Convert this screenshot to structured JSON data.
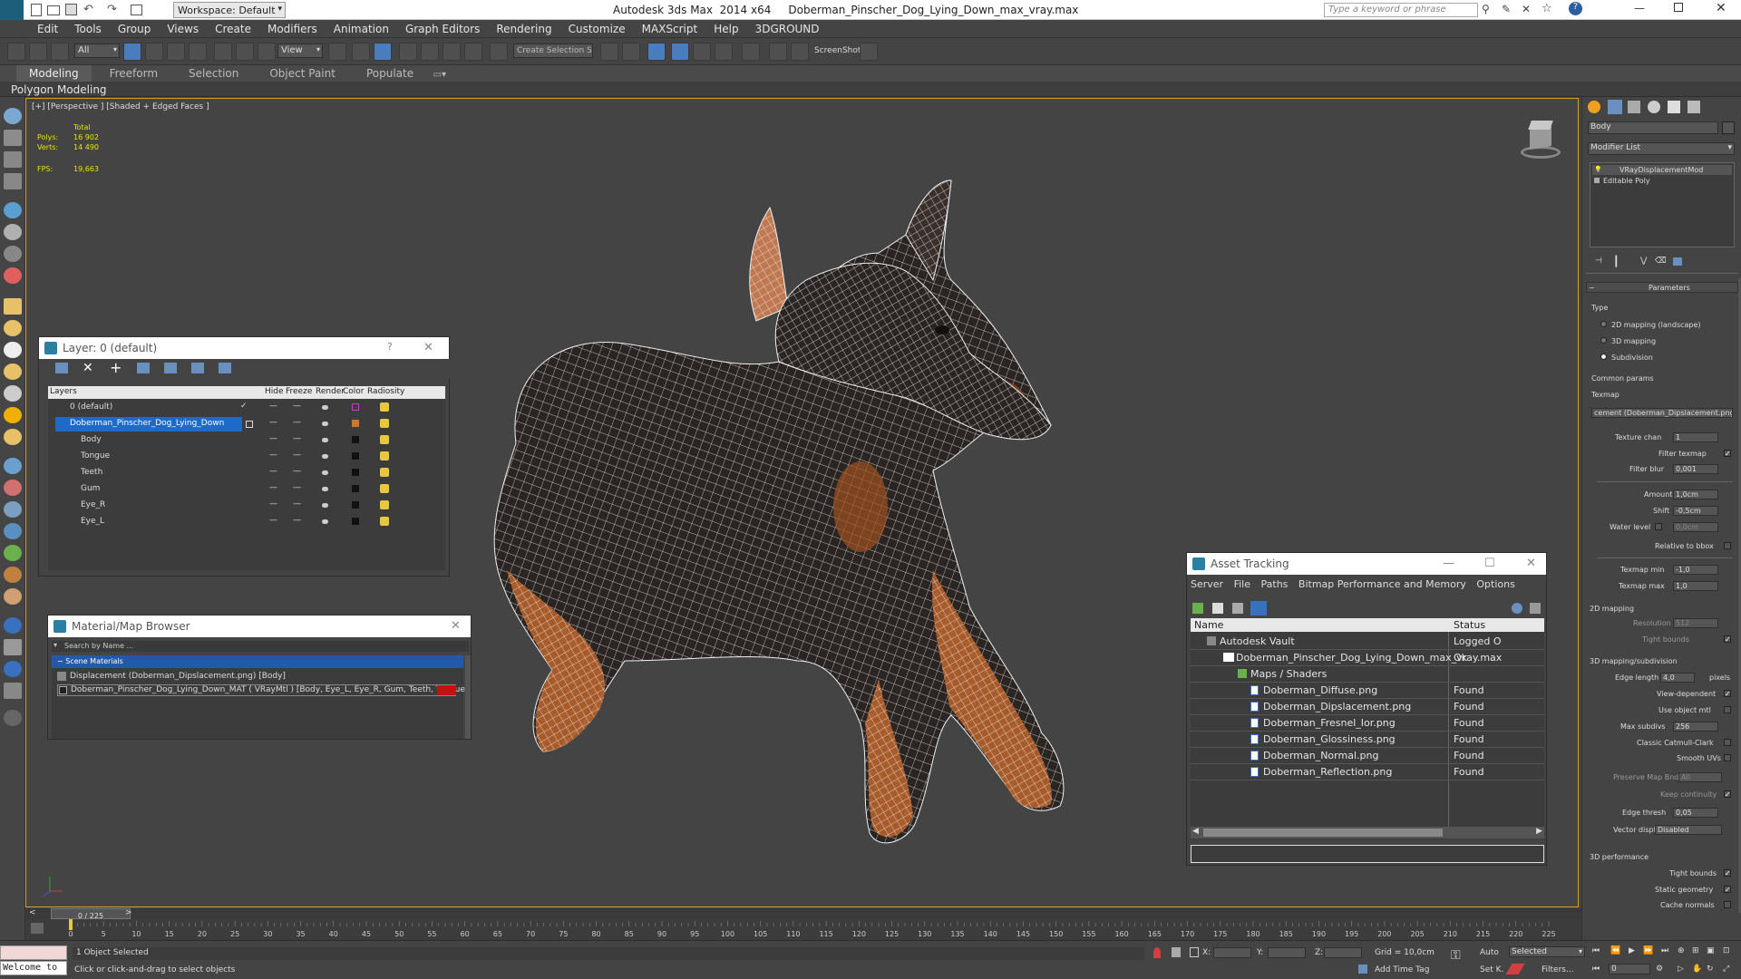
{
  "app": {
    "title": "Autodesk 3ds Max  2014 x64     Doberman_Pinscher_Dog_Lying_Down_max_vray.max",
    "workspace": "Workspace: Default",
    "search_placeholder": "Type a keyword or phrase"
  },
  "menu": [
    "Edit",
    "Tools",
    "Group",
    "Views",
    "Create",
    "Modifiers",
    "Animation",
    "Graph Editors",
    "Rendering",
    "Customize",
    "MAXScript",
    "Help",
    "3DGROUND"
  ],
  "toolbar": {
    "filter": "All",
    "ref_coord": "View",
    "selection_set": "Create Selection S",
    "screenshot": "ScreenShot"
  },
  "ribbon": {
    "tabs": [
      "Modeling",
      "Freeform",
      "Selection",
      "Object Paint",
      "Populate"
    ],
    "active": "Modeling",
    "sub": "Polygon Modeling"
  },
  "viewport": {
    "label": "[+] [Perspective ] [Shaded + Edged Faces ]",
    "stats": {
      "total": "Total",
      "polys_label": "Polys:",
      "polys": "16 902",
      "verts_label": "Verts:",
      "verts": "14 490",
      "fps_label": "FPS:",
      "fps": "19,663"
    }
  },
  "layer_panel": {
    "title": "Layer: 0 (default)",
    "columns": [
      "Layers",
      "Hide",
      "Freeze",
      "Render",
      "Color",
      "Radiosity"
    ],
    "rows": [
      {
        "name": "0 (default)",
        "color": "#c83cc8"
      },
      {
        "name": "Doberman_Pinscher_Dog_Lying_Down",
        "color": "#c87832"
      },
      {
        "name": "Body",
        "color": "#111111"
      },
      {
        "name": "Tongue",
        "color": "#111111"
      },
      {
        "name": "Teeth",
        "color": "#111111"
      },
      {
        "name": "Gum",
        "color": "#111111"
      },
      {
        "name": "Eye_R",
        "color": "#111111"
      },
      {
        "name": "Eye_L",
        "color": "#111111"
      }
    ]
  },
  "material_browser": {
    "title": "Material/Map Browser",
    "search": "Search by Name ...",
    "group": "Scene Materials",
    "items": [
      "Displacement (Doberman_Dipslacement.png) [Body]",
      "Doberman_Pinscher_Dog_Lying_Down_MAT  ( VRayMtl )  [Body, Eye_L, Eye_R, Gum, Teeth, Tongue]"
    ]
  },
  "asset_tracking": {
    "title": "Asset Tracking",
    "menu": [
      "Server",
      "File",
      "Paths",
      "Bitmap Performance and Memory",
      "Options"
    ],
    "columns": [
      "Name",
      "Status"
    ],
    "rows": [
      {
        "name": "Autodesk Vault",
        "status": "Logged O"
      },
      {
        "name": "Doberman_Pinscher_Dog_Lying_Down_max_vray.max",
        "status": "Ok"
      },
      {
        "name": "Maps / Shaders",
        "status": ""
      },
      {
        "name": "Doberman_Diffuse.png",
        "status": "Found"
      },
      {
        "name": "Doberman_Dipslacement.png",
        "status": "Found"
      },
      {
        "name": "Doberman_Fresnel_Ior.png",
        "status": "Found"
      },
      {
        "name": "Doberman_Glossiness.png",
        "status": "Found"
      },
      {
        "name": "Doberman_Normal.png",
        "status": "Found"
      },
      {
        "name": "Doberman_Reflection.png",
        "status": "Found"
      }
    ]
  },
  "command_panel": {
    "object_name": "Body",
    "modifier_list": "Modifier List",
    "stack": [
      "VRayDisplacementMod",
      "Editable Poly"
    ],
    "rollout": "Parameters",
    "type_label": "Type",
    "types": [
      "2D mapping (landscape)",
      "3D mapping",
      "Subdivision"
    ],
    "common": "Common params",
    "texmap_label": "Texmap",
    "texmap": "cement (Doberman_Dipslacement.png)",
    "texture_chan_label": "Texture chan",
    "texture_chan": "1",
    "filter_texmap": "Filter texmap",
    "filter_blur_label": "Filter blur",
    "filter_blur": "0,001",
    "amount_label": "Amount",
    "amount": "1,0cm",
    "shift_label": "Shift",
    "shift": "-0,5cm",
    "water_label": "Water level",
    "water": "0,0cm",
    "relative_bbox": "Relative to bbox",
    "texmap_min_label": "Texmap min",
    "texmap_min": "-1,0",
    "texmap_max_label": "Texmap max",
    "texmap_max": "1,0",
    "mapping2d": "2D mapping",
    "resolution_label": "Resolution",
    "resolution": "512",
    "tight_bounds": "Tight bounds",
    "mapping3d": "3D mapping/subdivision",
    "edge_length_label": "Edge length",
    "edge_length": "4,0",
    "pixels": "pixels",
    "view_dependent": "View-dependent",
    "use_object_mtl": "Use object mtl",
    "max_subdivs_label": "Max subdivs",
    "max_subdivs": "256",
    "classic_catmull": "Classic Catmull-Clark",
    "smooth_uvs": "Smooth UVs",
    "preserve_map": "Preserve Map Bnd",
    "preserve_map_val": "All",
    "keep_continuity": "Keep continuity",
    "edge_thresh_label": "Edge thresh",
    "edge_thresh": "0,05",
    "vector_displ_label": "Vector displ",
    "vector_displ": "Disabled",
    "perf": "3D performance",
    "static_geometry": "Static geometry",
    "cache_normals": "Cache normals"
  },
  "timeline": {
    "frame": "0 / 225",
    "ticks": [
      "0",
      "5",
      "10",
      "15",
      "20",
      "25",
      "30",
      "35",
      "40",
      "45",
      "50",
      "55",
      "60",
      "65",
      "70",
      "75",
      "80",
      "85",
      "90",
      "95",
      "100",
      "105",
      "110",
      "115",
      "120",
      "125",
      "130",
      "135",
      "140",
      "145",
      "150",
      "155",
      "160",
      "165",
      "170",
      "175",
      "180",
      "185",
      "190",
      "195",
      "200",
      "205",
      "210",
      "215",
      "220",
      "225"
    ]
  },
  "status": {
    "welcome": "Welcome to",
    "selected": "1 Object Selected",
    "hint": "Click or click-and-drag to select objects",
    "x": "X:",
    "y": "Y:",
    "z": "Z:",
    "grid": "Grid = 10,0cm",
    "add_time_tag": "Add Time Tag",
    "auto": "Auto",
    "selected_dd": "Selected",
    "set_k": "Set K.",
    "filters": "Filters...",
    "frame": "0"
  }
}
